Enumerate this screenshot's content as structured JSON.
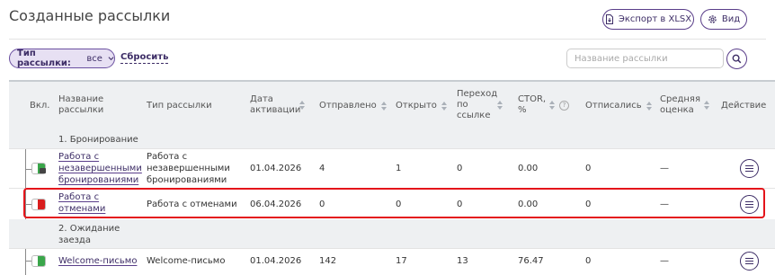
{
  "page": {
    "title": "Созданные рассылки"
  },
  "toolbar": {
    "export_label": "Экспорт в XLSX",
    "view_label": "Вид"
  },
  "filters": {
    "type_label": "Тип рассылки:",
    "type_value": "все",
    "reset_label": "Сбросить",
    "search_placeholder": "Название рассылки"
  },
  "table": {
    "columns": {
      "enabled": "Вкл.",
      "name": "Название рассылки",
      "type": "Тип рассылки",
      "activation_date": "Дата активации",
      "sent": "Отправлено",
      "opened": "Открыто",
      "clicked": "Переход по ссылке",
      "ctor": "CTOR, %",
      "unsubscribed": "Отписались",
      "rating": "Средняя оценка",
      "action": "Действие"
    },
    "groups": [
      {
        "label": "1. Бронирование",
        "rows": [
          {
            "name": "Работа с незавершенными бронированиями",
            "type": "Работа с незавершенными бронированиями",
            "date": "01.04.2026",
            "sent": "4",
            "opened": "1",
            "clicked": "0",
            "ctor": "0.00",
            "unsubscribed": "0",
            "rating": "—",
            "enabled": true,
            "locked": true
          },
          {
            "name": "Работа с отменами",
            "type": "Работа с отменами",
            "date": "06.04.2026",
            "sent": "0",
            "opened": "0",
            "clicked": "0",
            "ctor": "0.00",
            "unsubscribed": "0",
            "rating": "—",
            "enabled": false,
            "locked": false
          }
        ]
      },
      {
        "label": "2. Ожидание заезда",
        "rows": [
          {
            "name": "Welcome-письмо",
            "type": "Welcome-письмо",
            "date": "01.04.2026",
            "sent": "142",
            "opened": "17",
            "clicked": "13",
            "ctor": "76.47",
            "unsubscribed": "0",
            "rating": "—",
            "enabled": true,
            "locked": false
          }
        ]
      }
    ]
  },
  "colors": {
    "accent": "#3d2d66",
    "chip_bg": "#e7e0f3",
    "on": "#3aa64a",
    "off": "#d91e1e",
    "highlight": "#e4141a"
  }
}
